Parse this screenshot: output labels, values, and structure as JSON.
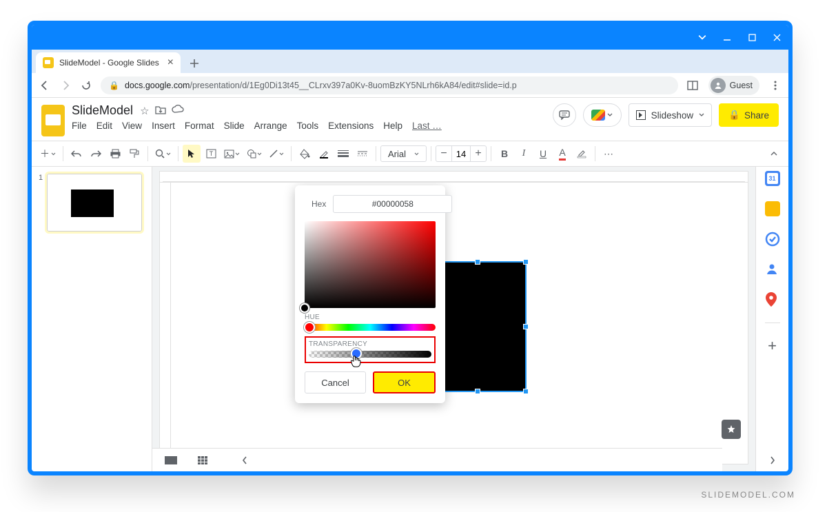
{
  "window": {
    "tab_title": "SlideModel - Google Slides",
    "url_host": "docs.google.com",
    "url_path": "/presentation/d/1Eg0Di13t45__CLrxv397a0Kv-8uomBzKY5NLrh6kA84/edit#slide=id.p",
    "guest_label": "Guest"
  },
  "header": {
    "doc_title": "SlideModel",
    "slideshow_label": "Slideshow",
    "share_label": "Share",
    "menu": [
      "File",
      "Edit",
      "View",
      "Insert",
      "Format",
      "Slide",
      "Arrange",
      "Tools",
      "Extensions",
      "Help"
    ],
    "last_edit": "Last …"
  },
  "toolbar": {
    "font_name": "Arial",
    "font_size": "14"
  },
  "filmstrip": {
    "slide_number": "1"
  },
  "picker": {
    "hex_label": "Hex",
    "hex_value": "#00000058",
    "hue_label": "HUE",
    "transparency_label": "TRANSPARENCY",
    "cancel_label": "Cancel",
    "ok_label": "OK"
  },
  "watermark": "SLIDEMODEL.COM"
}
